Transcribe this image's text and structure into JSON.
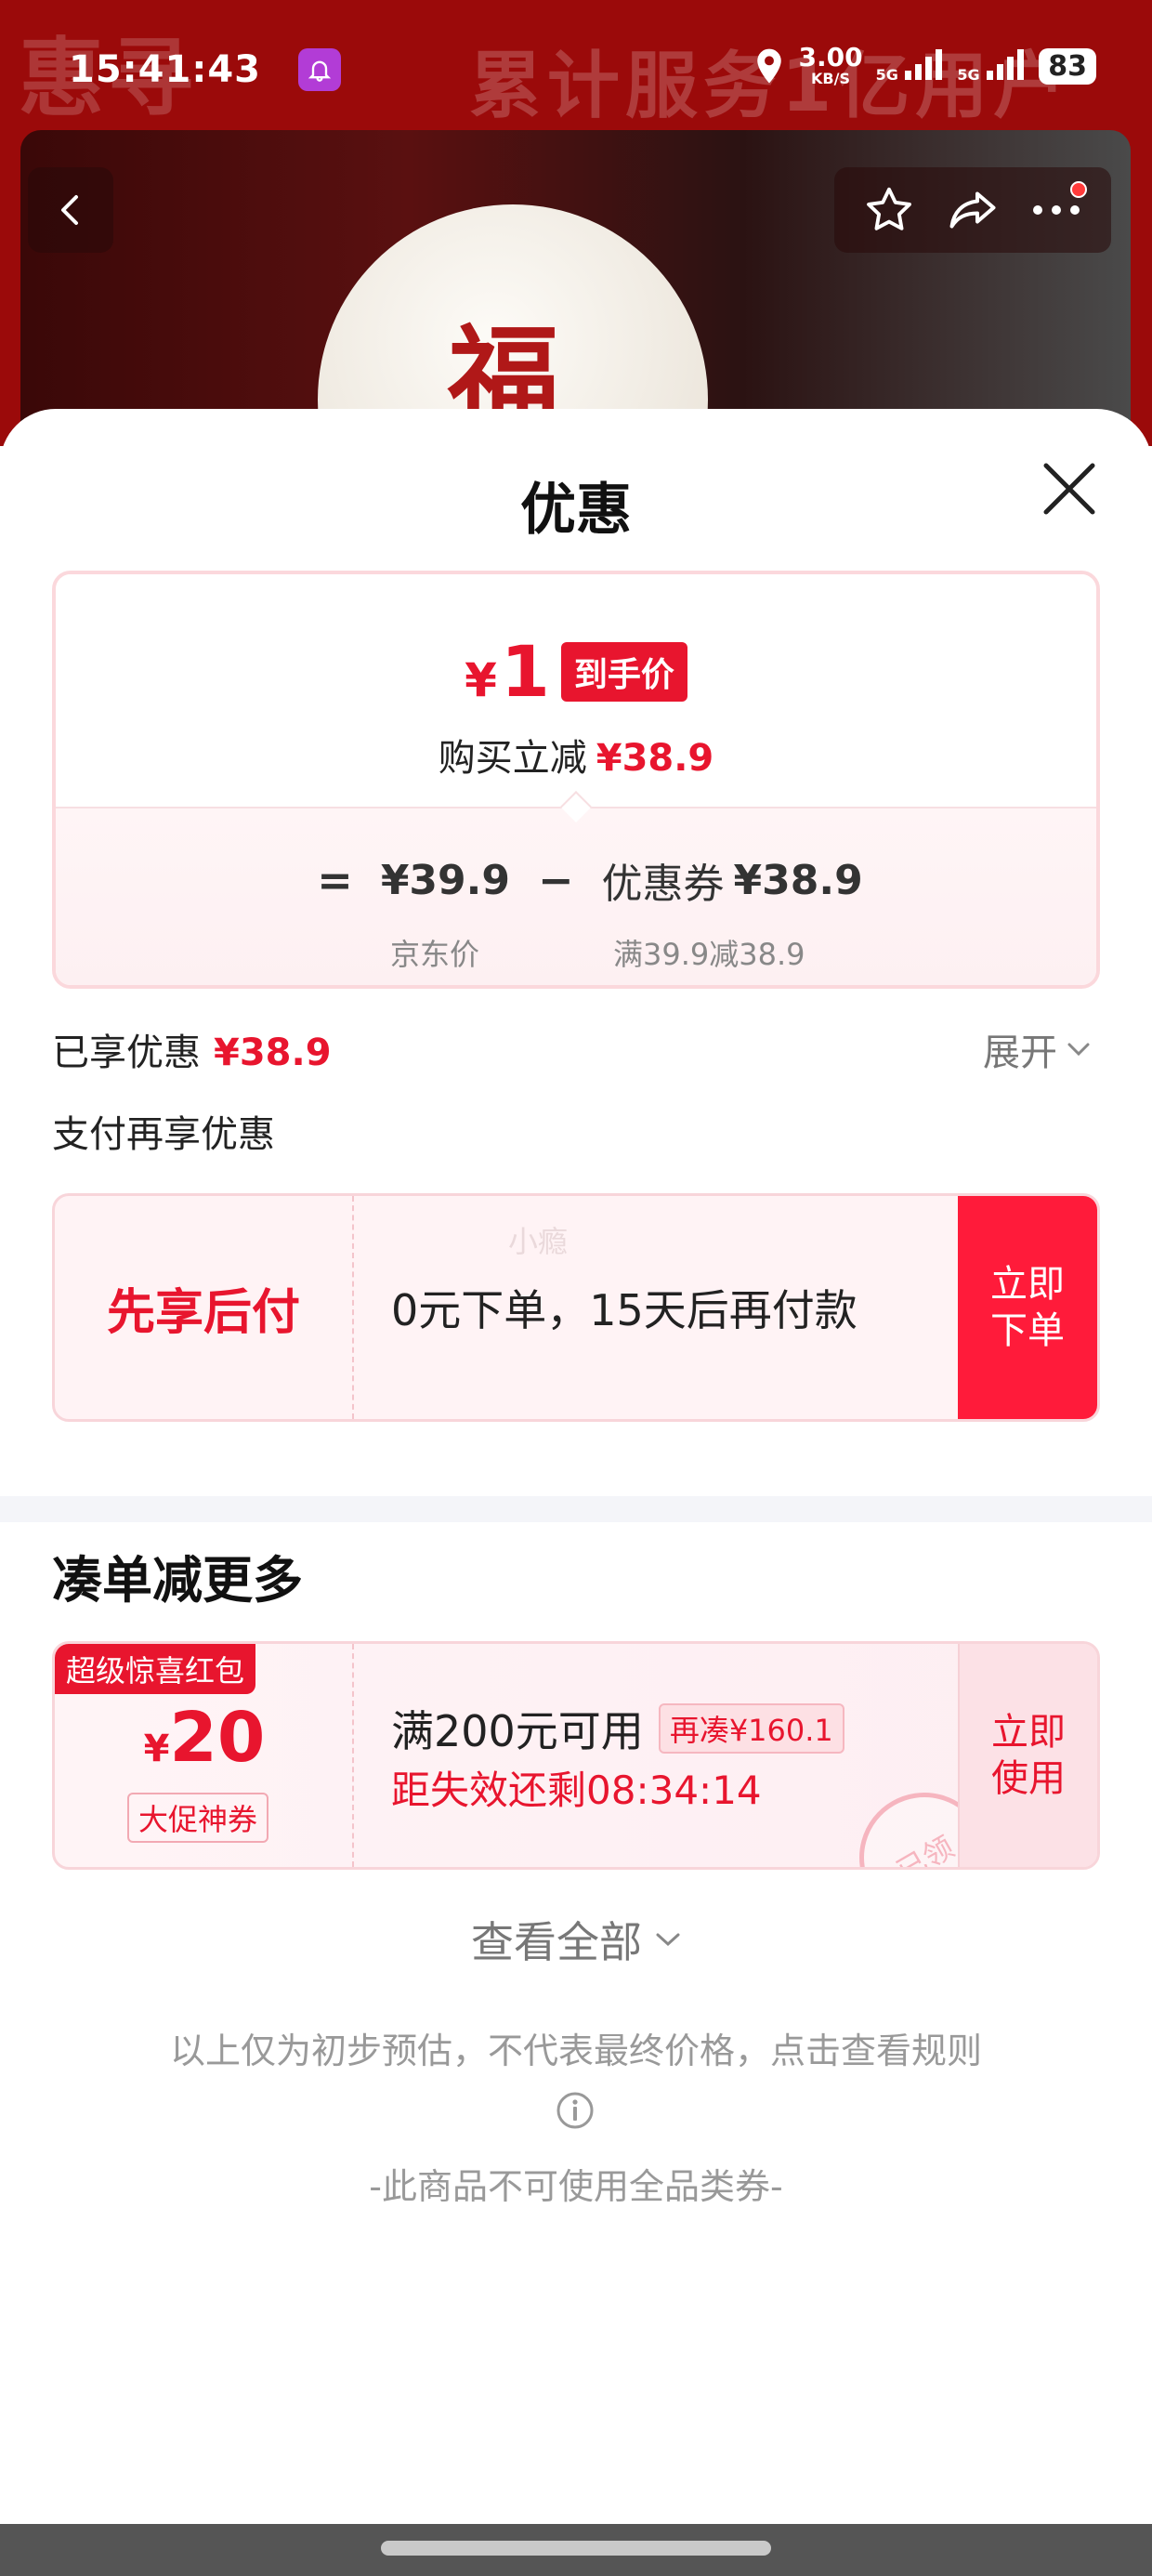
{
  "status_bar": {
    "time": "15:41:43",
    "net_speed": "3.00",
    "net_unit": "KB/S",
    "sim1": "5G",
    "sim2": "5G",
    "battery": "83"
  },
  "background": {
    "brand_text": "惠寻",
    "banner_text": "累计服务1亿用户"
  },
  "sheet": {
    "title": "优惠",
    "price_card": {
      "currency": "¥",
      "final_price": "1",
      "final_tag": "到手价",
      "reduce_label": "购买立减",
      "reduce_amount": "¥38.9",
      "formula_eq": "=",
      "jd_price": "¥39.9",
      "formula_minus": "−",
      "coupon_label": "优惠券",
      "coupon_amount": "¥38.9",
      "jd_price_label": "京东价",
      "coupon_cond": "满39.9减38.9"
    },
    "enjoyed_label": "已享优惠",
    "enjoyed_amount": "¥38.9",
    "expand_label": "展开",
    "pay_more_label": "支付再享优惠",
    "bnpl": {
      "title": "先享后付",
      "watermark": "小瘾",
      "description": "0元下单，15天后再付款",
      "button": "立即下单"
    },
    "more_section_title": "凑单减更多",
    "coupon": {
      "badge": "超级惊喜红包",
      "currency": "¥",
      "amount": "20",
      "type": "大促神券",
      "condition": "满200元可用",
      "condition_tag": "再凑¥160.1",
      "countdown": "距失效还剩08:34:14",
      "button": "立即使用",
      "stamp": "已领"
    },
    "view_all": "查看全部",
    "disclaimer": "以上仅为初步预估，不代表最终价格，点击查看规则",
    "no_coupon_note": "-此商品不可使用全品类券-"
  },
  "colors": {
    "accent": "#e8152e",
    "card_border": "#fbd8dc",
    "bnpl_button": "#ff1b3a"
  },
  "icons": [
    "back-icon",
    "star-icon",
    "share-icon",
    "more-icon",
    "close-icon",
    "chevron-down-icon",
    "info-icon",
    "bell-icon",
    "location-icon",
    "signal-icon"
  ]
}
